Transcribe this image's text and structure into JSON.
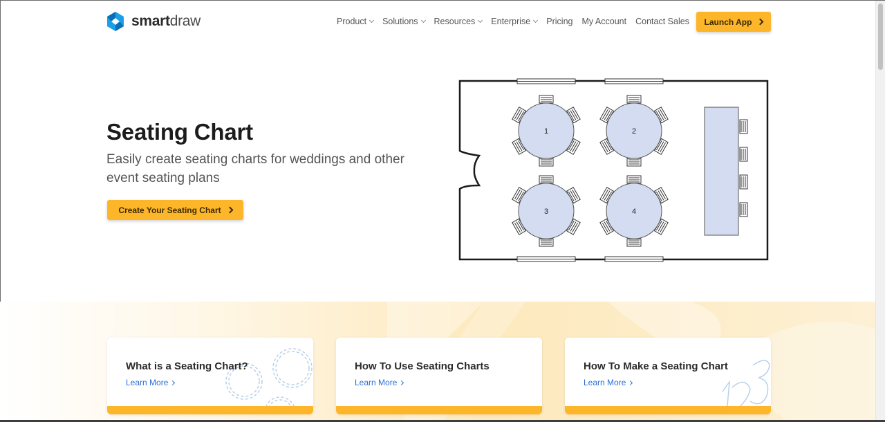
{
  "brand": {
    "name_bold": "smart",
    "name_light": "draw",
    "colors": {
      "accent": "#fdb52a",
      "logo_blue": "#1aa0e8",
      "logo_dark": "#0b6fb8",
      "link": "#2a6fd6",
      "table_fill": "#d3dcf0"
    }
  },
  "nav": {
    "items": [
      {
        "label": "Product",
        "dropdown": true
      },
      {
        "label": "Solutions",
        "dropdown": true
      },
      {
        "label": "Resources",
        "dropdown": true
      },
      {
        "label": "Enterprise",
        "dropdown": true
      },
      {
        "label": "Pricing",
        "dropdown": false
      },
      {
        "label": "My Account",
        "dropdown": false
      },
      {
        "label": "Contact Sales",
        "dropdown": false
      }
    ],
    "launch_label": "Launch App"
  },
  "hero": {
    "title": "Seating Chart",
    "subtitle": "Easily create seating charts for weddings and other event seating plans",
    "cta_label": "Create Your Seating Chart"
  },
  "diagram": {
    "tables": [
      "1",
      "2",
      "3",
      "4"
    ]
  },
  "cards": [
    {
      "title": "What is a Seating Chart?",
      "link": "Learn More",
      "art": "gear-circles"
    },
    {
      "title": "How To Use Seating Charts",
      "link": "Learn More",
      "art": "none"
    },
    {
      "title": "How To Make a Seating Chart",
      "link": "Learn More",
      "art": "123-outline"
    }
  ]
}
